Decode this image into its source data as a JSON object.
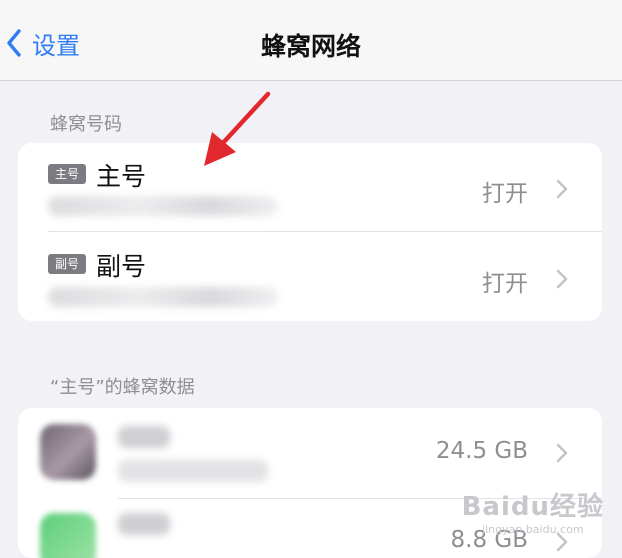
{
  "navbar": {
    "back_label": "设置",
    "title": "蜂窝网络"
  },
  "cellular_numbers": {
    "header": "蜂窝号码",
    "lines": [
      {
        "badge": "主号",
        "name": "主号",
        "status": "打开"
      },
      {
        "badge": "副号",
        "name": "副号",
        "status": "打开"
      }
    ]
  },
  "cellular_data": {
    "header": "“主号”的蜂窝数据",
    "apps": [
      {
        "usage": "24.5 GB"
      },
      {
        "usage": "8.8 GB"
      }
    ]
  },
  "watermark": {
    "brand": "Baidu经验",
    "domain": "jingyan.baidu.com"
  },
  "colors": {
    "accent": "#2f7cf6",
    "annotation_arrow": "#e0282e"
  }
}
